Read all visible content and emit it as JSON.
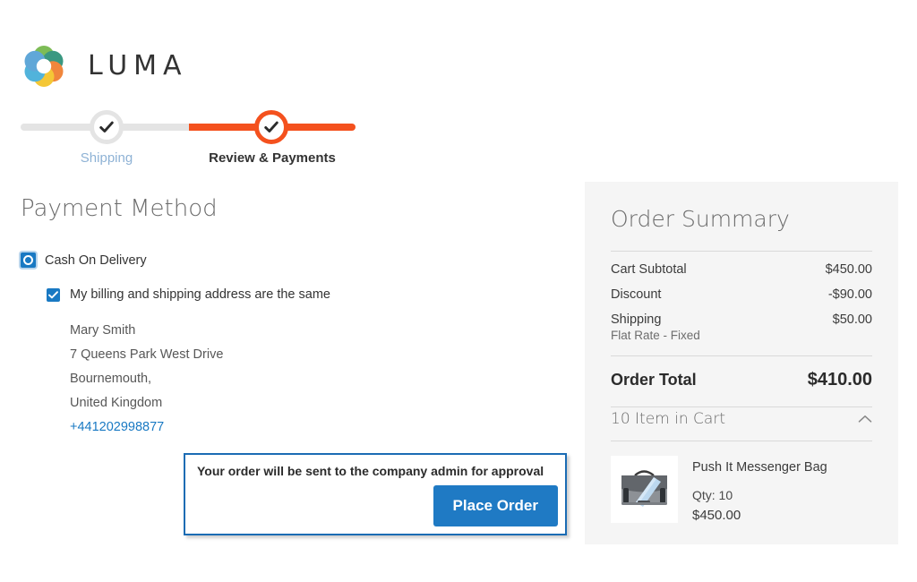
{
  "brand": {
    "name": "LUMA",
    "logo_icon": "luma-flower-logo",
    "logo_colors": [
      "#4b9cd3",
      "#6cb33f",
      "#1f8a70",
      "#ef7622",
      "#f3c01b",
      "#3aa9d7"
    ]
  },
  "checkout_progress": {
    "steps": [
      {
        "label": "Shipping",
        "state": "complete",
        "icon": "check-icon"
      },
      {
        "label": "Review & Payments",
        "state": "active",
        "icon": "check-icon"
      }
    ],
    "complete_color": "#f4511e",
    "incomplete_color": "#e4e4e4"
  },
  "payment": {
    "title": "Payment Method",
    "methods": [
      {
        "label": "Cash On Delivery",
        "selected": true
      }
    ],
    "billing_same_checkbox": {
      "label": "My billing and shipping address are the same",
      "checked": true
    },
    "address": {
      "name": "Mary Smith",
      "street": "7 Queens Park West Drive",
      "city": "Bournemouth,",
      "country": "United Kingdom",
      "phone": "+441202998877"
    }
  },
  "order_action": {
    "approval_note": "Your order will be sent to the company admin for approval",
    "place_order_label": "Place Order",
    "button_color": "#1f7ac4",
    "highlight_border_color": "#1b6cb4"
  },
  "order_summary": {
    "title": "Order Summary",
    "totals": [
      {
        "label": "Cart Subtotal",
        "sublabel": "",
        "value": "$450.00"
      },
      {
        "label": "Discount",
        "sublabel": "",
        "value": "-$90.00"
      },
      {
        "label": "Shipping",
        "sublabel": "Flat Rate - Fixed",
        "value": "$50.00"
      }
    ],
    "grand_total": {
      "label": "Order Total",
      "value": "$410.00"
    },
    "cart": {
      "toggle_label": "10 Item in Cart",
      "toggle_icon": "chevron-up-icon",
      "expanded": true,
      "items": [
        {
          "name": "Push It Messenger Bag",
          "qty_label": "Qty: 10",
          "price": "$450.00",
          "thumb_icon": "messenger-bag-thumbnail"
        }
      ]
    }
  }
}
